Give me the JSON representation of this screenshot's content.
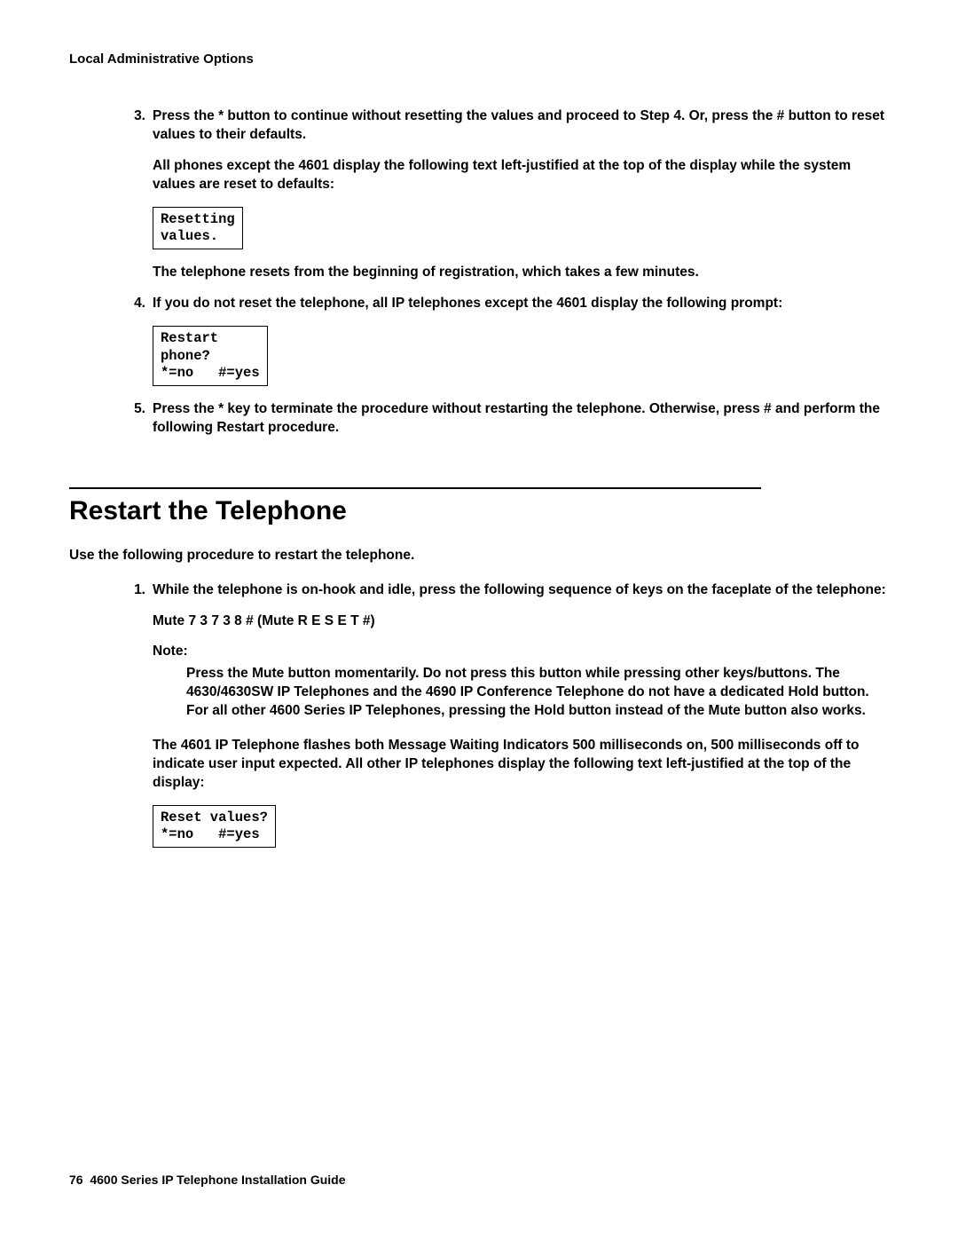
{
  "running_head": "Local Administrative Options",
  "step3_text": "Press the * button to continue without resetting the values and proceed to Step 4. Or, press the # button to reset values to their defaults.",
  "step3_after": "All phones except the 4601 display the following text left-justified at the top of the display while the system values are reset to defaults:",
  "box1": "Resetting\nvalues.",
  "step3_tail": "The telephone resets from the beginning of registration, which takes a few minutes.",
  "step4_text": "If you do not reset the telephone, all IP telephones except the 4601 display the following prompt:",
  "box2": "Restart\nphone?\n*=no   #=yes",
  "step5_text": "Press the * key to terminate the procedure without restarting the telephone. Otherwise, press # and perform the following Restart procedure.",
  "section_title": "Restart the Telephone",
  "intro": "Use the following procedure to restart the telephone.",
  "r_step1_text": "While the telephone is on-hook and idle, press the following sequence of keys on the faceplate of the telephone:",
  "mute_seq": "Mute 7 3 7 3 8 # (Mute R E S E T #)",
  "note_label": "Note:",
  "note_body": "Press the Mute button momentarily. Do not press this button while pressing other keys/buttons. The 4630/4630SW IP Telephones and the 4690 IP Conference Telephone do not have a dedicated Hold button. For all other 4600 Series IP Telephones, pressing the Hold button instead of the Mute button also works.",
  "r_step1_after": "The 4601 IP Telephone flashes both Message Waiting Indicators 500 milliseconds on, 500 milliseconds off to indicate user input expected. All other IP telephones display the following text left-justified at the top of the display:",
  "box3": "Reset values?\n*=no   #=yes",
  "footer_page": "76",
  "footer_title": "4600 Series IP Telephone Installation Guide"
}
